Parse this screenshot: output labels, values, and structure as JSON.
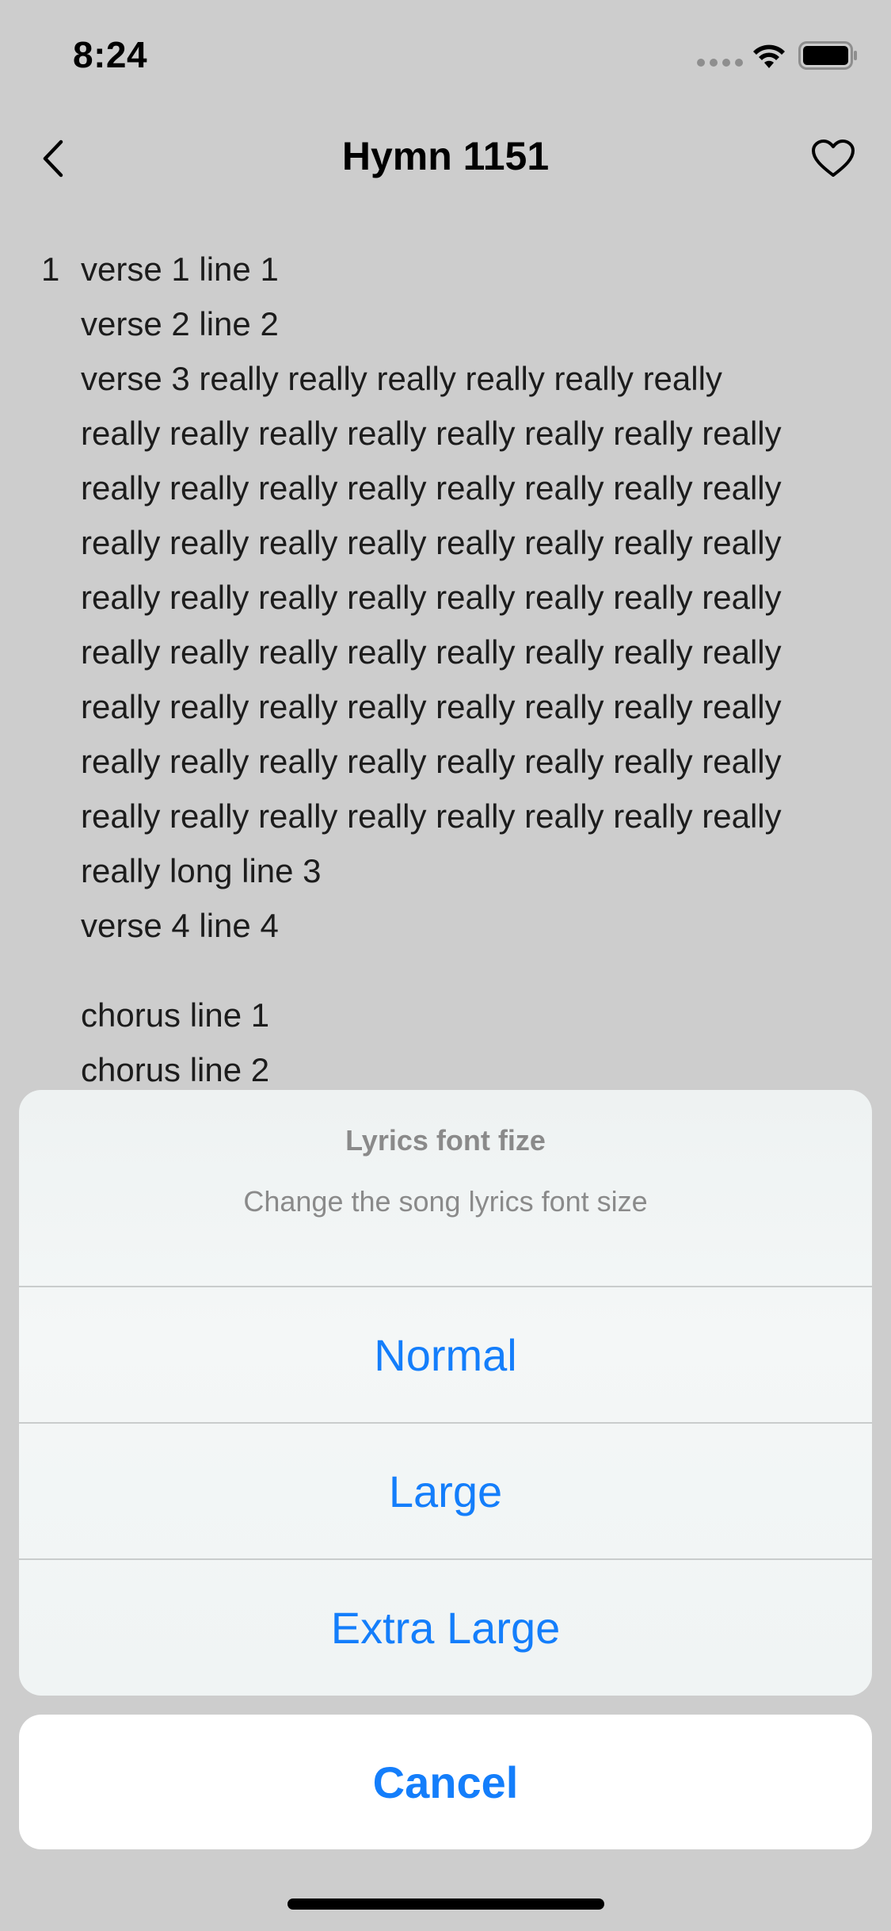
{
  "status_bar": {
    "time": "8:24",
    "icons": [
      "signal-dots-icon",
      "wifi-icon",
      "battery-icon"
    ]
  },
  "nav": {
    "back_icon": "chevron-left-icon",
    "title": "Hymn 1151",
    "favorite_icon": "heart-outline-icon"
  },
  "lyrics": {
    "verse": {
      "number": "1",
      "lines": [
        "verse 1 line 1",
        "verse 2 line 2",
        "verse 3 really really really really really really",
        "really really really really really really really really",
        "really really really really really really really really",
        "really really really really really really really really",
        "really really really really really really really really",
        "really really really really really really really really",
        "really really really really really really really really",
        "really really really really really really really really",
        "really really really really really really really really",
        "really long line 3",
        "verse 4 line 4"
      ]
    },
    "chorus": {
      "lines": [
        "chorus line 1",
        "chorus line 2"
      ]
    }
  },
  "action_sheet": {
    "title": "Lyrics font fize",
    "message": "Change the song lyrics font size",
    "options": [
      "Normal",
      "Large",
      "Extra Large"
    ],
    "cancel": "Cancel"
  },
  "colors": {
    "accent": "#147efb",
    "dimmed_background": "#cdcdcd",
    "secondary_text": "#8a8a8a"
  }
}
